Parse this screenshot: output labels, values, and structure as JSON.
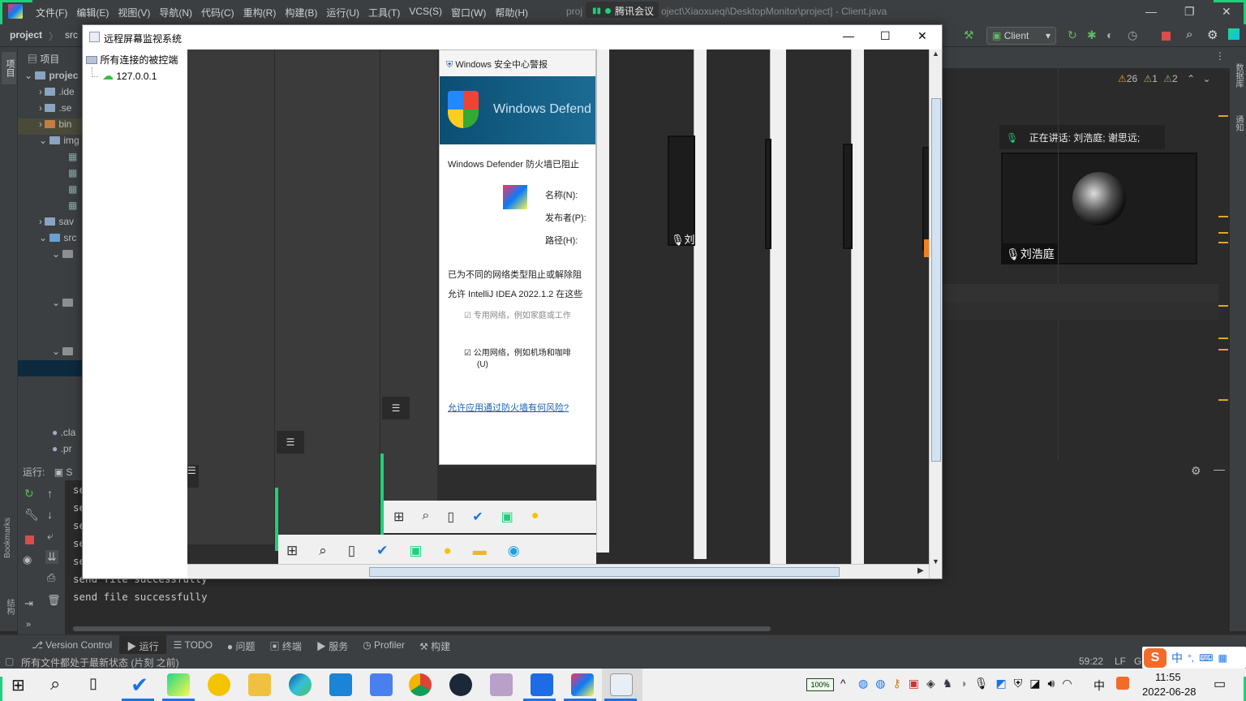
{
  "ide": {
    "menus": [
      "文件(F)",
      "编辑(E)",
      "视图(V)",
      "导航(N)",
      "代码(C)",
      "重构(R)",
      "构建(B)",
      "运行(U)",
      "工具(T)",
      "VCS(S)",
      "窗口(W)",
      "帮助(H)"
    ],
    "title_left": "proj",
    "title_right": "oject\\Xiaoxueqi\\DesktopMonitor\\project] - Client.java",
    "meeting_label": "腾讯会议",
    "breadcrumb": [
      "project",
      "src"
    ],
    "run_config": "Client",
    "inspections": {
      "warnings": "26",
      "weak_warnings": "1",
      "typos": "2"
    },
    "left_strip_label": "项目",
    "bookmarks_label": "Bookmarks",
    "structure_label": "结构",
    "right_strip_labels": [
      "数据库",
      "通知"
    ]
  },
  "project_tree": {
    "header": "项目",
    "rows": [
      "projec",
      ".ide",
      ".se",
      "bin",
      "img",
      "",
      "",
      "",
      "",
      "sav",
      "src",
      "",
      "",
      "",
      ".cla",
      ".pr"
    ]
  },
  "run_panel": {
    "label": "运行:",
    "tab": "S",
    "lines": [
      "se",
      "se",
      "se",
      "se",
      "se",
      "send file successfully",
      "send file successfully"
    ]
  },
  "bottom_tools": [
    "Version Control",
    "运行",
    "TODO",
    "问题",
    "终端",
    "服务",
    "Profiler",
    "构建"
  ],
  "status": {
    "message": "所有文件都处于最新状态 (片刻 之前)",
    "position": "59:22",
    "line_sep": "LF",
    "encoding": "GI"
  },
  "swing_window": {
    "title": "远程屏幕监视系统",
    "tree_root": "所有连接的被控端",
    "tree_child": "127.0.0.1"
  },
  "remote_screen": {
    "defender_header": "Windows 安全中心警报",
    "defender_banner": "Windows Defend",
    "defender_msg": "Windows Defender 防火墙已阻止",
    "name_label": "名称(N):",
    "publisher_label": "发布者(P):",
    "path_label": "路径(H):",
    "blocked_text": "已为不同的网络类型阻止或解除阻",
    "allow_text": "允许 IntelliJ IDEA 2022.1.2 在这些",
    "private_net": "专用网络，例如家庭或工作",
    "public_net": "公用网络，例如机场和咖啡",
    "public_net2": "(U)",
    "risk_link": "允许应用通过防火墙有何风险?",
    "speaking": "正在讲话: 刘浩庭; 谢思远;",
    "speaker_name": "刘浩庭",
    "small_label": "刘"
  },
  "taskbar": {
    "battery": "100%",
    "time": "11:55",
    "date": "2022-06-28",
    "ime_lang": "中"
  },
  "colors": {
    "ide_bg": "#2b2b2b",
    "ide_panel": "#3c3f41",
    "taskbar": "#f0f0f0",
    "accent_green": "#1fd07a"
  }
}
